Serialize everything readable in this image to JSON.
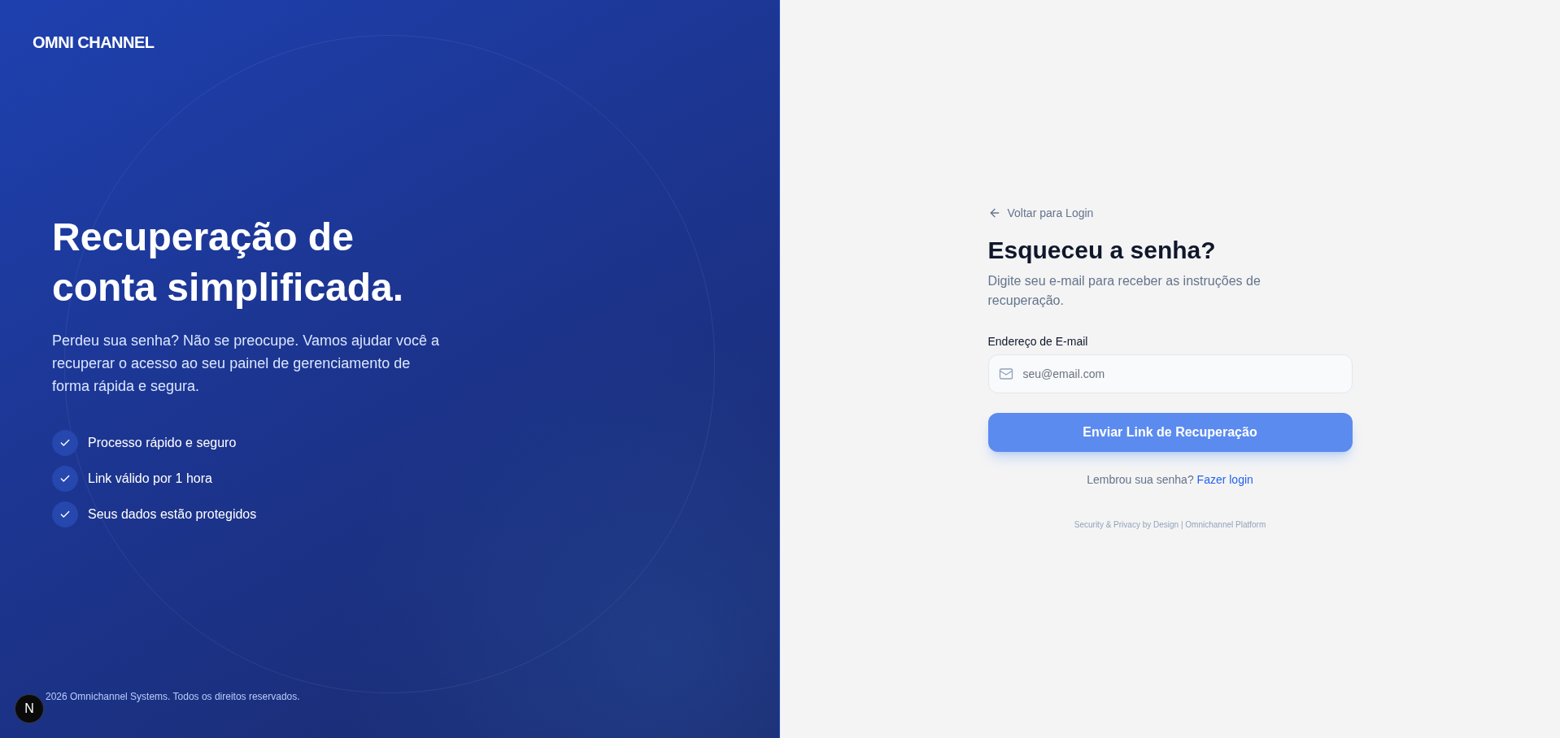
{
  "brand": {
    "logo_text": "OMNI CHANNEL"
  },
  "hero": {
    "title": "Recuperação de conta simplificada.",
    "description": "Perdeu sua senha? Não se preocupe. Vamos ajudar você a recuperar o acesso ao seu painel de gerenciamento de forma rápida e segura.",
    "features": [
      {
        "label": "Processo rápido e seguro"
      },
      {
        "label": "Link válido por 1 hora"
      },
      {
        "label": "Seus dados estão protegidos"
      }
    ],
    "copyright": "2026 Omnichannel Systems. Todos os direitos reservados."
  },
  "dev_badge": {
    "label": "N"
  },
  "form": {
    "back_link": "Voltar para Login",
    "title": "Esqueceu a senha?",
    "subtitle": "Digite seu e-mail para receber as instruções de recuperação.",
    "email_field": {
      "label": "Endereço de E-mail",
      "placeholder": "seu@email.com"
    },
    "submit_button": "Enviar Link de Recuperação",
    "login_prompt": {
      "text": "Lembrou sua senha?",
      "link": "Fazer login"
    },
    "footer_note": "Security & Privacy by Design | Omnichannel Platform"
  }
}
